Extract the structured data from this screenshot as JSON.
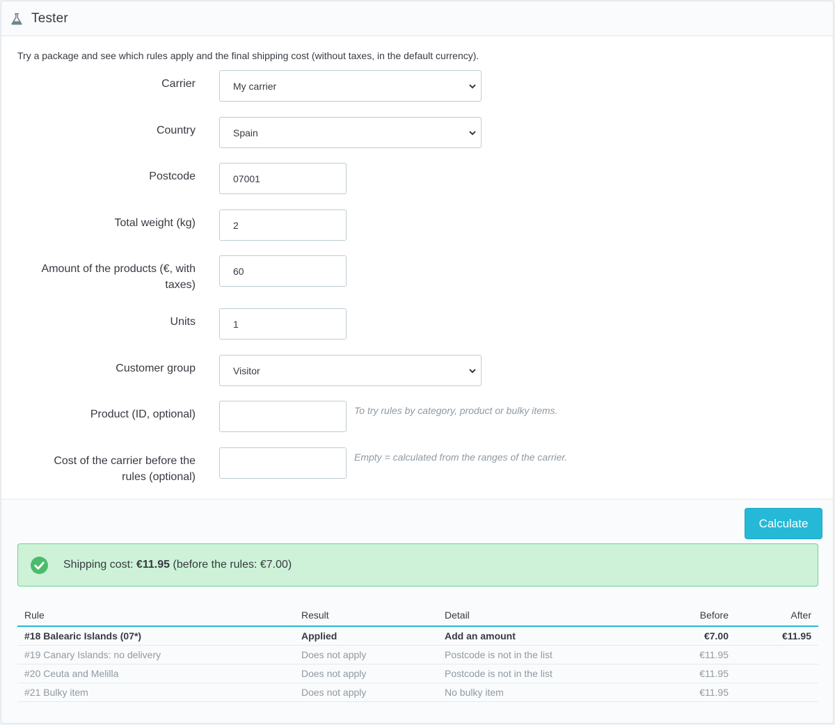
{
  "header": {
    "title": "Tester",
    "icon": "flask-icon"
  },
  "intro": "Try a package and see which rules apply and the final shipping cost (without taxes, in the default currency).",
  "form": {
    "carrier": {
      "label": "Carrier",
      "value": "My carrier"
    },
    "country": {
      "label": "Country",
      "value": "Spain"
    },
    "postcode": {
      "label": "Postcode",
      "value": "07001"
    },
    "weight": {
      "label": "Total weight (kg)",
      "value": "2"
    },
    "amount": {
      "label_line1": "Amount of the products (€, with",
      "label_line2": "taxes)",
      "value": "60"
    },
    "units": {
      "label": "Units",
      "value": "1"
    },
    "group": {
      "label": "Customer group",
      "value": "Visitor"
    },
    "product": {
      "label": "Product (ID, optional)",
      "value": "",
      "help": "To try rules by category, product or bulky items."
    },
    "cost": {
      "label_line1": "Cost of the carrier before the",
      "label_line2": "rules (optional)",
      "value": "",
      "help": "Empty = calculated from the ranges of the carrier."
    }
  },
  "calculate_label": "Calculate",
  "result": {
    "prefix": "Shipping cost:",
    "amount": "€11.95",
    "suffix": "(before the rules: €7.00)"
  },
  "table": {
    "headers": {
      "rule": "Rule",
      "result": "Result",
      "detail": "Detail",
      "before": "Before",
      "after": "After"
    },
    "rows": [
      {
        "rule": "#18 Balearic Islands (07*)",
        "result": "Applied",
        "detail": "Add an amount",
        "before": "€7.00",
        "after": "€11.95"
      },
      {
        "rule": "#19 Canary Islands: no delivery",
        "result": "Does not apply",
        "detail": "Postcode is not in the list",
        "before": "€11.95",
        "after": ""
      },
      {
        "rule": "#20 Ceuta and Melilla",
        "result": "Does not apply",
        "detail": "Postcode is not in the list",
        "before": "€11.95",
        "after": ""
      },
      {
        "rule": "#21 Bulky item",
        "result": "Does not apply",
        "detail": "No bulky item",
        "before": "€11.95",
        "after": ""
      }
    ]
  },
  "colors": {
    "accent": "#25b9d7",
    "success_bg": "#cdf2d8",
    "success_icon": "#4cbb6c"
  }
}
